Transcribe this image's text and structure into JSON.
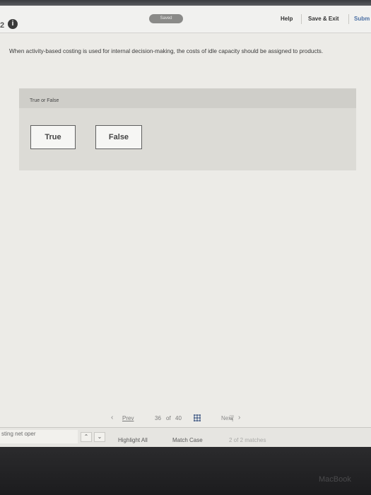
{
  "header": {
    "question_number": "2",
    "saved_label": "Saved",
    "help_label": "Help",
    "save_exit_label": "Save & Exit",
    "submit_label": "Subm"
  },
  "question": {
    "text": "When activity-based costing is used for internal decision-making, the costs of idle capacity should be assigned to products."
  },
  "answer": {
    "type_label": "True or False",
    "options": [
      "True",
      "False"
    ]
  },
  "pagination": {
    "prev_label": "Prev",
    "current": "36",
    "of_label": "of",
    "total": "40",
    "next_label": "Next"
  },
  "findbar": {
    "search_value": "sting net oper",
    "highlight_all_label": "Highlight All",
    "match_case_label": "Match Case",
    "status": "2 of 2 matches"
  },
  "bezel": {
    "brand_text": "MacBook"
  }
}
